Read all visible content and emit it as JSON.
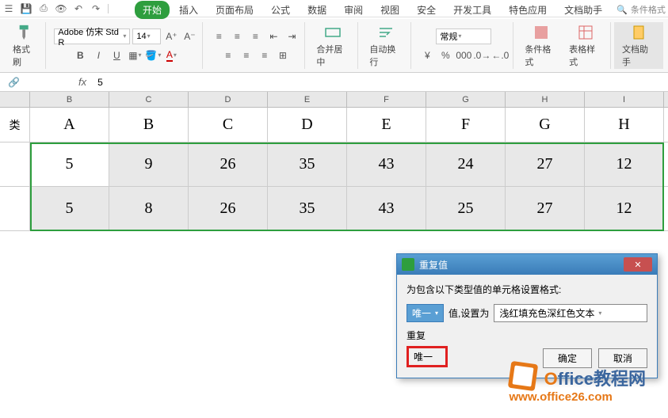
{
  "ribbon_tabs": [
    "开始",
    "插入",
    "页面布局",
    "公式",
    "数据",
    "审阅",
    "视图",
    "安全",
    "开发工具",
    "特色应用",
    "文档助手"
  ],
  "search_placeholder": "条件格式",
  "font": {
    "name": "Adobe 仿宋 Std R",
    "size": "14"
  },
  "number_format": "常规",
  "big_buttons": {
    "format_painter": "格式刷",
    "merge_center": "合并居中",
    "auto_wrap": "自动换行",
    "cond_format": "条件格式",
    "table_style": "表格样式",
    "doc_helper": "文档助手"
  },
  "formula_bar": {
    "fx": "fx",
    "value": "5"
  },
  "col_letters": [
    "B",
    "C",
    "D",
    "E",
    "F",
    "G",
    "H",
    "I"
  ],
  "row_labels": [
    "类",
    "",
    ""
  ],
  "header_row": [
    "A",
    "B",
    "C",
    "D",
    "E",
    "F",
    "G",
    "H"
  ],
  "data_rows": [
    [
      "5",
      "9",
      "26",
      "35",
      "43",
      "24",
      "27",
      "12"
    ],
    [
      "5",
      "8",
      "26",
      "35",
      "43",
      "25",
      "27",
      "12"
    ]
  ],
  "dialog": {
    "title": "重复值",
    "desc": "为包含以下类型值的单元格设置格式:",
    "type_selected": "唯一",
    "set_as": "值,设置为",
    "format_selected": "浅红填充色深红色文本",
    "opt_dup": "重复",
    "opt_uniq": "唯一",
    "ok": "确定",
    "cancel": "取消"
  },
  "watermark": {
    "line1a": "O",
    "line1b": "ffice教程网",
    "line2": "www.office26.com"
  },
  "chart_data": {
    "type": "table",
    "columns": [
      "A",
      "B",
      "C",
      "D",
      "E",
      "F",
      "G",
      "H"
    ],
    "rows": [
      [
        5,
        9,
        26,
        35,
        43,
        24,
        27,
        12
      ],
      [
        5,
        8,
        26,
        35,
        43,
        25,
        27,
        12
      ]
    ]
  }
}
